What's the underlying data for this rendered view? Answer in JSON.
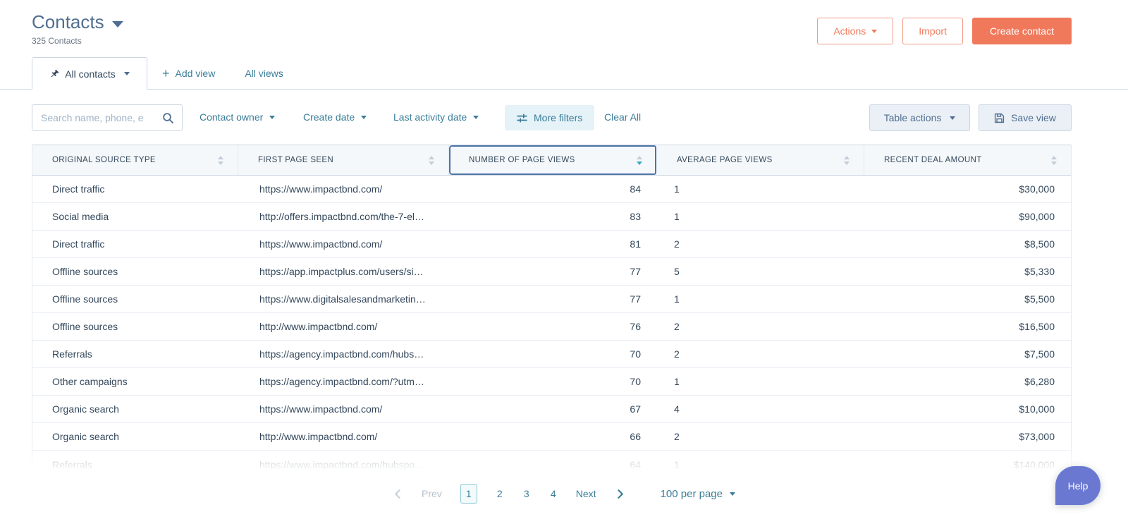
{
  "page": {
    "title": "Contacts",
    "subtitle": "325 Contacts"
  },
  "header_actions": {
    "actions_label": "Actions",
    "import_label": "Import",
    "create_label": "Create contact"
  },
  "tabs": {
    "current_view": "All contacts",
    "add_view": "Add view",
    "all_views": "All views"
  },
  "filters": {
    "search_placeholder": "Search name, phone, e",
    "dropdowns": [
      "Contact owner",
      "Create date",
      "Last activity date"
    ],
    "more_filters": "More filters",
    "clear_all": "Clear All",
    "table_actions": "Table actions",
    "save_view": "Save view"
  },
  "table": {
    "columns": [
      {
        "label": "ORIGINAL SOURCE TYPE",
        "selected": false
      },
      {
        "label": "FIRST PAGE SEEN",
        "selected": false
      },
      {
        "label": "NUMBER OF PAGE VIEWS",
        "selected": true,
        "sort": "desc"
      },
      {
        "label": "AVERAGE PAGE VIEWS",
        "selected": false
      },
      {
        "label": "RECENT DEAL AMOUNT",
        "selected": false
      }
    ],
    "rows": [
      {
        "source": "Direct traffic",
        "url": "https://www.impactbnd.com/",
        "views": "84",
        "avg": "1",
        "amount": "$30,000"
      },
      {
        "source": "Social media",
        "url": "http://offers.impactbnd.com/the-7-el…",
        "views": "83",
        "avg": "1",
        "amount": "$90,000"
      },
      {
        "source": "Direct traffic",
        "url": "https://www.impactbnd.com/",
        "views": "81",
        "avg": "2",
        "amount": "$8,500"
      },
      {
        "source": "Offline sources",
        "url": "https://app.impactplus.com/users/si…",
        "views": "77",
        "avg": "5",
        "amount": "$5,330"
      },
      {
        "source": "Offline sources",
        "url": "https://www.digitalsalesandmarketin…",
        "views": "77",
        "avg": "1",
        "amount": "$5,500"
      },
      {
        "source": "Offline sources",
        "url": "http://www.impactbnd.com/",
        "views": "76",
        "avg": "2",
        "amount": "$16,500"
      },
      {
        "source": "Referrals",
        "url": "https://agency.impactbnd.com/hubs…",
        "views": "70",
        "avg": "2",
        "amount": "$7,500"
      },
      {
        "source": "Other campaigns",
        "url": "https://agency.impactbnd.com/?utm…",
        "views": "70",
        "avg": "1",
        "amount": "$6,280"
      },
      {
        "source": "Organic search",
        "url": "https://www.impactbnd.com/",
        "views": "67",
        "avg": "4",
        "amount": "$10,000"
      },
      {
        "source": "Organic search",
        "url": "http://www.impactbnd.com/",
        "views": "66",
        "avg": "2",
        "amount": "$73,000"
      },
      {
        "source": "Referrals",
        "url": "https://www.impactbnd.com/hubspo…",
        "views": "64",
        "avg": "1",
        "amount": "$140,000",
        "faded": true
      }
    ]
  },
  "pagination": {
    "prev_label": "Prev",
    "pages": [
      "1",
      "2",
      "3",
      "4"
    ],
    "current": "1",
    "next_label": "Next",
    "per_page": "100 per page"
  },
  "help": {
    "label": "Help"
  },
  "colors": {
    "accent_orange": "#f0795c",
    "link_teal": "#3a7d98",
    "text_navy": "#33475b",
    "title_blue": "#516f90",
    "selected_column_border": "#4e74a8",
    "header_bg": "#f5f8fa",
    "border_gray": "#cbd6e2",
    "help_purple": "#6a78d1"
  }
}
